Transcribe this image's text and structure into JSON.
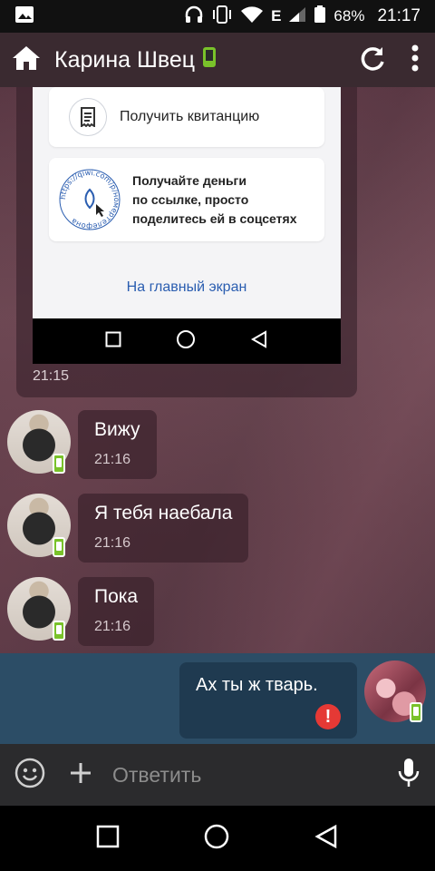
{
  "status_bar": {
    "battery_percent": "68%",
    "clock": "21:17",
    "network_label": "E",
    "icons": [
      "image-icon",
      "headphones-icon",
      "vibrate-icon",
      "wifi-icon",
      "signal-icon",
      "battery-icon"
    ]
  },
  "app_bar": {
    "title": "Карина Швец",
    "icons": [
      "home-icon",
      "online-mobile-icon",
      "refresh-icon",
      "more-vertical-icon"
    ]
  },
  "screenshot_image": {
    "card1_text": "Получить квитанцию",
    "card2_text_line1": "Получайте деньги",
    "card2_text_line2": "по ссылке, просто",
    "card2_text_line3": "поделитесь ей в соцсетях",
    "sticker_text": "https://qiwi.com/p/номертелефона",
    "home_link": "На главный экран",
    "time": "21:15"
  },
  "messages": [
    {
      "text": "Вижу",
      "time": "21:16"
    },
    {
      "text": "Я тебя наебала",
      "time": "21:16"
    },
    {
      "text": "Пока",
      "time": "21:16"
    }
  ],
  "outgoing": {
    "text": "Ах ты ж тварь.",
    "status": "!"
  },
  "input": {
    "placeholder": "Ответить"
  },
  "colors": {
    "app_bar": "#3a2a30",
    "outgoing_band": "#2c4d66",
    "online_badge": "#79c22a",
    "error": "#e53935",
    "link": "#2a5db0"
  }
}
